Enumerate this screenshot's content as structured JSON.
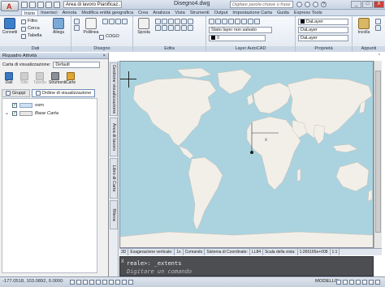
{
  "title_bar": {
    "app_name": "Area di lavoro Pianificaz...",
    "document_title": "Disegno4.dwg",
    "search_placeholder": "Digitare parola chiave o frase",
    "window_controls": [
      "_",
      "□",
      "X"
    ]
  },
  "ribbon_tabs": [
    {
      "label": "Inizio",
      "active": true
    },
    {
      "label": "Inserisci",
      "active": false
    },
    {
      "label": "Annota",
      "active": false
    },
    {
      "label": "Modifica entità geografica",
      "active": false
    },
    {
      "label": "Crea",
      "active": false
    },
    {
      "label": "Analizza",
      "active": false
    },
    {
      "label": "Vista",
      "active": false
    },
    {
      "label": "Strumenti",
      "active": false
    },
    {
      "label": "Output",
      "active": false
    },
    {
      "label": "Impostazione Carta",
      "active": false
    },
    {
      "label": "Guida",
      "active": false
    },
    {
      "label": "Express Tools",
      "active": false
    }
  ],
  "ribbon": {
    "dati": {
      "title": "Dati",
      "connect_label": "Connetti",
      "filtro_label": "Filtro",
      "cerca_label": "Cerca",
      "tabella_label": "Tabella",
      "allega_label": "Allega"
    },
    "disegno": {
      "title": "Disegno",
      "polilinea_label": "Polilinea",
      "cogo_label": "COGO"
    },
    "edita": {
      "title": "Edita",
      "sposta_label": "Sposta"
    },
    "layer": {
      "title": "Layer AutoCAD",
      "stato_layer": "Stato layer non salvato",
      "layer_value": "0"
    },
    "proprieta": {
      "title": "Proprietà",
      "color_value": "DaLayer",
      "linetype_value": "DaLayer",
      "lineweight_value": "DaLayer"
    },
    "appunti": {
      "title": "Appunti",
      "incolla_label": "Incolla"
    }
  },
  "palette": {
    "title": "Riquadro Attività",
    "carta_label": "Carta di visualizzazione:",
    "carta_value": "Default",
    "tools": [
      {
        "label": "Dati",
        "enabled": true
      },
      {
        "label": "Stile",
        "enabled": false
      },
      {
        "label": "Tabella",
        "enabled": false
      },
      {
        "label": "Strumenti",
        "enabled": true
      },
      {
        "label": "Carte",
        "enabled": true
      }
    ],
    "subtabs": [
      {
        "label": "Gruppi",
        "active": false
      },
      {
        "label": "Ordine di visualizzazione",
        "active": true
      }
    ],
    "layers": [
      {
        "name": "osm",
        "checked": true
      },
      {
        "name": "Base Carta",
        "checked": true
      }
    ]
  },
  "vertical_tabs": [
    "Gestione visualizzazione",
    "Area di lavoro",
    "Libro di Carte",
    "Rileva"
  ],
  "model_strip": [
    "3D",
    "Esagerazione verticale:",
    "1x",
    "Comando",
    "Sistema di Coordinate:",
    "LL84",
    "Scala della vista:",
    "1:266165e+008",
    "1:1"
  ],
  "command_line": {
    "history": "reale>: _extents",
    "prompt": "Digitare un comando",
    "close_glyph": "X"
  },
  "status_bar": {
    "coordinates": "-177.0518, 103.0892, 0.0000",
    "model_label": "MODELLO"
  },
  "colors": {
    "ocean": "#aad3df",
    "land": "#f2efe9",
    "ribbon_bg": "#e3e9f1",
    "command_bg": "#4c4e52"
  }
}
